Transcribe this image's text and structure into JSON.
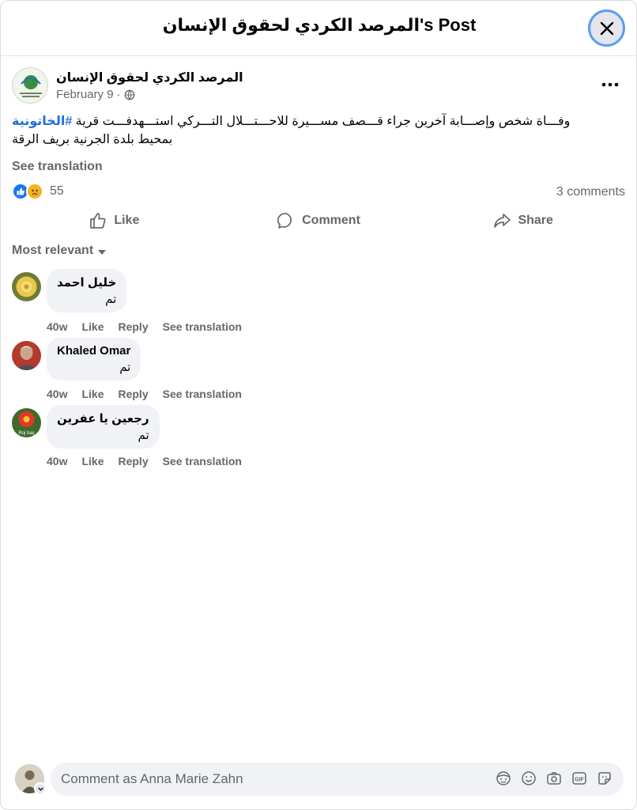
{
  "header": {
    "title": "المرصد الكردي لحقوق الإنسان's Post"
  },
  "post": {
    "page_name": "المرصد الكردي لحقوق الإنسان",
    "date": "February 9",
    "separator": "·",
    "text_main": "وفـــاة شخص وإصـــابة آخرين جراء قـــصف مســـيرة للاحـــتـــلال التـــركي استـــهدفـــت قرية ",
    "hashtag": "#الخاتونية",
    "text_line2": "بمحيط بلدة الجرنية بريف الرقة",
    "see_translation": "See translation",
    "reaction_count": "55",
    "comments_count": "3 comments",
    "icons": {
      "privacy": "globe-icon",
      "more": "more-icon"
    }
  },
  "actions": {
    "like": "Like",
    "comment": "Comment",
    "share": "Share"
  },
  "sort_label": "Most relevant",
  "comments": [
    {
      "name": "خليل احمد",
      "text": "تم",
      "age": "40w",
      "like": "Like",
      "reply": "Reply",
      "translate": "See translation"
    },
    {
      "name": "Khaled Omar",
      "text": "تم",
      "age": "40w",
      "like": "Like",
      "reply": "Reply",
      "translate": "See translation"
    },
    {
      "name": "رجعين يا عفرين",
      "text": "تم",
      "age": "40w",
      "like": "Like",
      "reply": "Reply",
      "translate": "See translation",
      "avatar_caption": "Roj baş"
    }
  ],
  "composer": {
    "placeholder": "Comment as Anna Marie Zahn"
  },
  "colors": {
    "link": "#216fdb",
    "secondary_text": "#65676b",
    "bubble": "#f0f2f5",
    "like": "#1877f2",
    "sad": "#f7b125"
  }
}
